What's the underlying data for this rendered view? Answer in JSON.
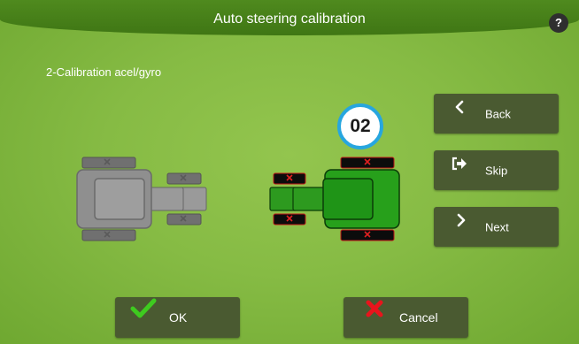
{
  "header": {
    "title": "Auto steering calibration",
    "help_label": "?"
  },
  "step": {
    "label": "2-Calibration acel/gyro",
    "badge": "02"
  },
  "side_buttons": {
    "back": {
      "label": "Back",
      "icon": "chevron-left-icon"
    },
    "skip": {
      "label": "Skip",
      "icon": "exit-arrow-icon"
    },
    "next": {
      "label": "Next",
      "icon": "chevron-right-icon"
    }
  },
  "footer": {
    "ok": {
      "label": "OK",
      "icon": "check-icon"
    },
    "cancel": {
      "label": "Cancel",
      "icon": "x-icon"
    }
  },
  "colors": {
    "title_bar": "#46801a",
    "badge_ring": "#27a6df",
    "active_tractor": "#27a01b",
    "inactive_tractor": "#8a8a8a",
    "button": "#4a5a31"
  }
}
